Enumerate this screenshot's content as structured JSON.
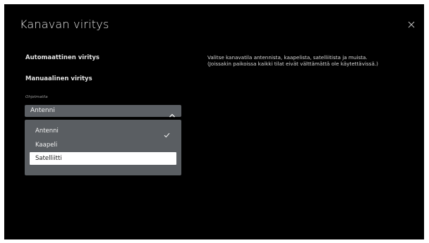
{
  "page": {
    "title": "Kanavan viritys"
  },
  "menu": {
    "items": [
      {
        "label": "Automaattinen viritys"
      },
      {
        "label": "Manuaalinen viritys"
      }
    ]
  },
  "program_mode": {
    "label": "Ohjelmatila",
    "selected": "Antenni",
    "expanded": true,
    "options": [
      {
        "label": "Antenni",
        "checked": true,
        "highlighted": false
      },
      {
        "label": "Kaapeli",
        "checked": false,
        "highlighted": false
      },
      {
        "label": "Satelliitti",
        "checked": false,
        "highlighted": true
      }
    ]
  },
  "description": {
    "line1": "Valitse kanavatila antennista, kaapelista, satelliitista ja muista.",
    "line2": "(Joissakin paikoissa kaikki tilat eivät välttämättä ole käytettävissä.)"
  },
  "colors": {
    "background": "#000000",
    "select_bg": "#5b5f64",
    "highlight": "#ffffff"
  }
}
